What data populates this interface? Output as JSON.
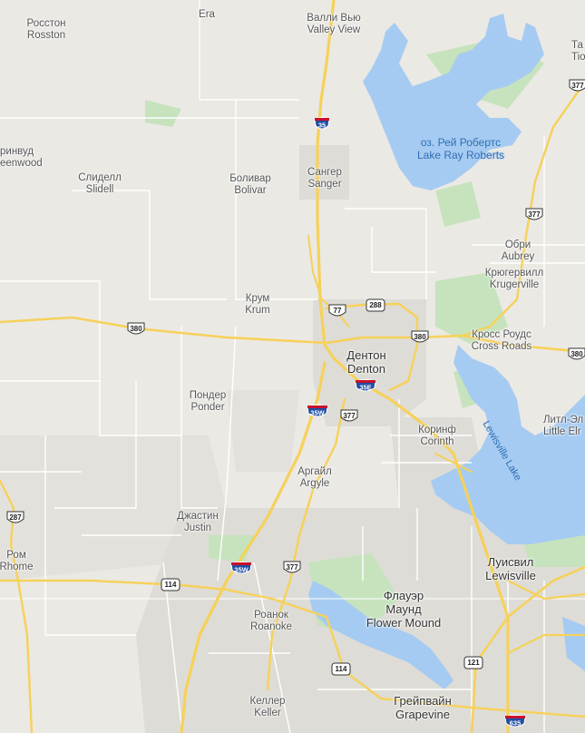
{
  "places": {
    "rosston": {
      "ru": "Росстон",
      "en": "Rosston"
    },
    "era": {
      "ru": "Era"
    },
    "valley_view": {
      "ru": "Валли Вью",
      "en": "Valley View"
    },
    "tioga": {
      "ru": "Та",
      "en": "Tio"
    },
    "greenwood": {
      "ru": "ринвуд",
      "en": "eenwood"
    },
    "slidell": {
      "ru": "Слиделл",
      "en": "Slidell"
    },
    "bolivar": {
      "ru": "Боливар",
      "en": "Bolivar"
    },
    "sanger": {
      "ru": "Сангер",
      "en": "Sanger"
    },
    "lake_ray_roberts": {
      "ru": "оз. Рей Робертс",
      "en": "Lake Ray Roberts"
    },
    "aubrey": {
      "ru": "Обри",
      "en": "Aubrey"
    },
    "krugerville": {
      "ru": "Крюгервилл",
      "en": "Krugerville"
    },
    "krum": {
      "ru": "Крум",
      "en": "Krum"
    },
    "denton": {
      "ru": "Дентон",
      "en": "Denton"
    },
    "cross_roads": {
      "ru": "Кросс Роудс",
      "en": "Cross Roads"
    },
    "ponder": {
      "ru": "Пондер",
      "en": "Ponder"
    },
    "corinth": {
      "ru": "Коринф",
      "en": "Corinth"
    },
    "little_elm": {
      "ru": "Литл-Эл",
      "en": "Little Elr"
    },
    "lewisville_lake": {
      "en": "Lewisville Lake"
    },
    "argyle": {
      "ru": "Аргайл",
      "en": "Argyle"
    },
    "justin": {
      "ru": "Джастин",
      "en": "Justin"
    },
    "rhome": {
      "ru": "Ром",
      "en": "Rhome"
    },
    "lewisville": {
      "ru": "Луисвил",
      "en": "Lewisville"
    },
    "flower_mound": {
      "ru": "Флауэр\nМаунд",
      "ru1": "Флауэр",
      "ru2": "Маунд",
      "en": "Flower Mound"
    },
    "roanoke": {
      "ru": "Роанок",
      "en": "Roanoke"
    },
    "keller": {
      "ru": "Келлер",
      "en": "Keller"
    },
    "grapevine": {
      "ru": "Грейпвайн",
      "en": "Grapevine"
    }
  },
  "shields": {
    "i35": "35",
    "us377_ne": "377",
    "us377_mid": "377",
    "us77": "77",
    "sh288": "288",
    "us380_w": "380",
    "us380_e": "380",
    "us380_edge": "380",
    "i35e": "35E",
    "i35w_n": "35W",
    "us377_s": "377",
    "sh287": "287",
    "sh114_w": "114",
    "i35w_s": "35W",
    "us377_sw": "377",
    "sh121": "121",
    "sh114_s": "114",
    "i635": "635"
  },
  "colors": {
    "land": "#ebe9e4",
    "water": "#a6cbf2",
    "park": "#c7e6c0",
    "highway": "#f7d25b",
    "urban": "#dad8d3"
  }
}
